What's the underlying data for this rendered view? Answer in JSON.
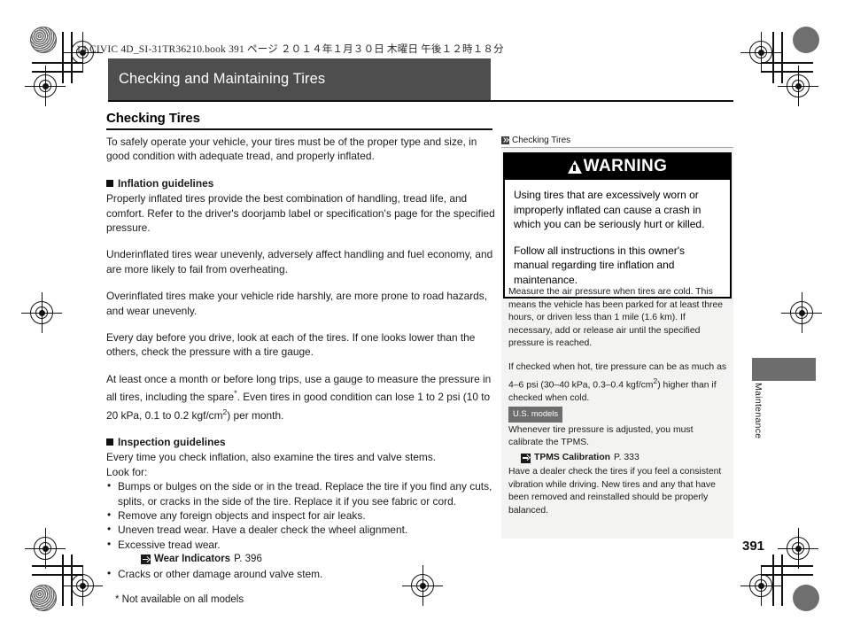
{
  "production_line": "14 CIVIC 4D_SI-31TR36210.book   391 ページ   ２０１４年１月３０日   木曜日   午後１２時１８分",
  "chapter_title": "Checking and Maintaining Tires",
  "section_title": "Checking Tires",
  "body": {
    "intro": "To safely operate your vehicle, your tires must be of the proper type and size, in good condition with adequate tread, and properly inflated.",
    "inflation_heading": "Inflation guidelines",
    "inflation_p1": "Properly inflated tires provide the best combination of handling, tread life, and comfort. Refer to the driver's doorjamb label or specification's page for the specified pressure.",
    "inflation_p2": "Underinflated tires wear unevenly, adversely affect handling and fuel economy, and are more likely to fail from overheating.",
    "inflation_p3": "Overinflated tires make your vehicle ride harshly, are more prone to road hazards, and wear unevenly.",
    "inflation_p4": "Every day before you drive, look at each of the tires. If one looks lower than the others, check the pressure with a tire gauge.",
    "inflation_p5_part1": "At least once a month or before long trips, use a gauge to measure the pressure in all tires, including the spare",
    "inflation_p5_asterisk": "*",
    "inflation_p5_part2": ". Even tires in good condition can lose 1 to 2 psi (10 to 20 kPa, 0.1 to 0.2 kgf/cm",
    "inflation_p5_sup": "2",
    "inflation_p5_part3": ") per month.",
    "inspection_heading": "Inspection guidelines",
    "inspection_intro": "Every time you check inflation, also examine the tires and valve stems.",
    "inspection_lookfor": "Look for:",
    "inspection_items": [
      "Bumps or bulges on the side or in the tread. Replace the tire if you find any cuts, splits, or cracks in the side of the tire. Replace it if you see fabric or cord.",
      "Remove any foreign objects and inspect for air leaks.",
      "Uneven tread wear. Have a dealer check the wheel alignment.",
      "Excessive tread wear.",
      "Cracks or other damage around valve stem."
    ],
    "wear_xref_title": "Wear Indicators",
    "wear_xref_page": "P. 396",
    "footnote": "* Not available on all models"
  },
  "sidebar": {
    "tab_label": "Checking Tires",
    "warning_label": "WARNING",
    "warning_p1": "Using tires that are excessively worn or improperly inflated can cause a crash in which you can be seriously hurt or killed.",
    "warning_p2": "Follow all instructions in this owner's manual regarding tire inflation and maintenance.",
    "note_p1": "Measure the air pressure when tires are cold. This means the vehicle has been parked for at least three hours, or driven less than 1 mile (1.6 km). If necessary, add or release air until the specified pressure is reached.",
    "note_p2_part1": "If checked when hot, tire pressure can be as much as 4–6 psi (30–40 kPa, 0.3–0.4 kgf/cm",
    "note_p2_sup": "2",
    "note_p2_part2": ") higher than if checked when cold.",
    "models_badge": "U.S. models",
    "note_p3": "Whenever tire pressure is adjusted, you must calibrate the TPMS.",
    "tpms_xref_title": "TPMS Calibration",
    "tpms_xref_page": "P. 333",
    "note_p4": "Have a dealer check the tires if you feel a consistent vibration while driving. New tires and any that have been removed and reinstalled should be properly balanced."
  },
  "thumb_label": "Maintenance",
  "page_number": "391",
  "colors": {
    "title_bar": "#4e4e4e",
    "panel_bg": "#f3f3f1",
    "badge": "#6d6d6d",
    "warning_bg": "#000000"
  }
}
